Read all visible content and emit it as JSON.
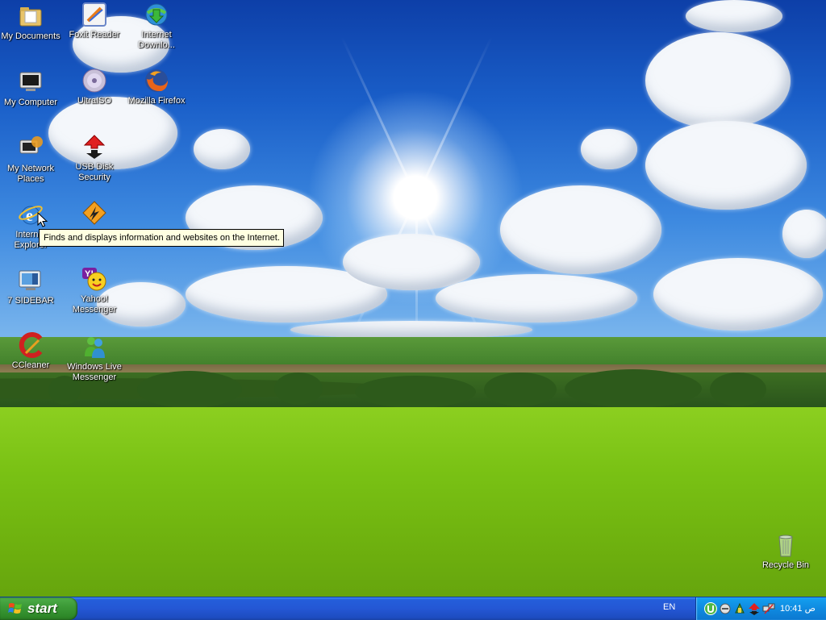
{
  "desktop_icons": [
    {
      "id": "my-documents",
      "label": "My Documents",
      "icon": "folder-icon"
    },
    {
      "id": "foxit-reader",
      "label": "Foxit Reader",
      "icon": "foxit-reader-icon"
    },
    {
      "id": "internet-download-manager",
      "label": "Internet Downlo...",
      "icon": "internet-download-manager-icon"
    },
    {
      "id": "my-computer",
      "label": "My Computer",
      "icon": "computer-icon"
    },
    {
      "id": "ultraiso",
      "label": "UltraISO",
      "icon": "disc-icon"
    },
    {
      "id": "mozilla-firefox",
      "label": "Mozilla Firefox",
      "icon": "firefox-icon"
    },
    {
      "id": "my-network-places",
      "label": "My Network Places",
      "icon": "network-icon"
    },
    {
      "id": "usb-disk-security",
      "label": "USB Disk Security",
      "icon": "usb-security-icon"
    },
    {
      "id": "internet-explorer",
      "label": "Internet Explorer",
      "icon": "internet-explorer-icon"
    },
    {
      "id": "winamp",
      "label": "",
      "icon": "winamp-icon"
    },
    {
      "id": "7-sidebar",
      "label": "7 SIDEBAR",
      "icon": "sidebar-icon"
    },
    {
      "id": "yahoo-messenger",
      "label": "Yahoo! Messenger",
      "icon": "yahoo-messenger-icon"
    },
    {
      "id": "ccleaner",
      "label": "CCleaner",
      "icon": "ccleaner-icon"
    },
    {
      "id": "windows-live-messenger",
      "label": "Windows Live Messenger",
      "icon": "live-messenger-icon"
    },
    {
      "id": "recycle-bin",
      "label": "Recycle Bin",
      "icon": "recycle-bin-icon"
    }
  ],
  "tooltip": {
    "text": "Finds and displays information and websites on the Internet."
  },
  "taskbar": {
    "start_label": "start",
    "language": "EN",
    "clock": "10:41 ص",
    "tray_icons": [
      "utorrent-icon",
      "status-icon",
      "network-tray-icon",
      "usb-security-tray-icon",
      "connection-tray-icon"
    ]
  },
  "colors": {
    "taskbar_blue": "#245edb",
    "start_green": "#3c9a37",
    "systray_blue": "#0f8ae0",
    "tooltip_bg": "#ffffe1"
  }
}
